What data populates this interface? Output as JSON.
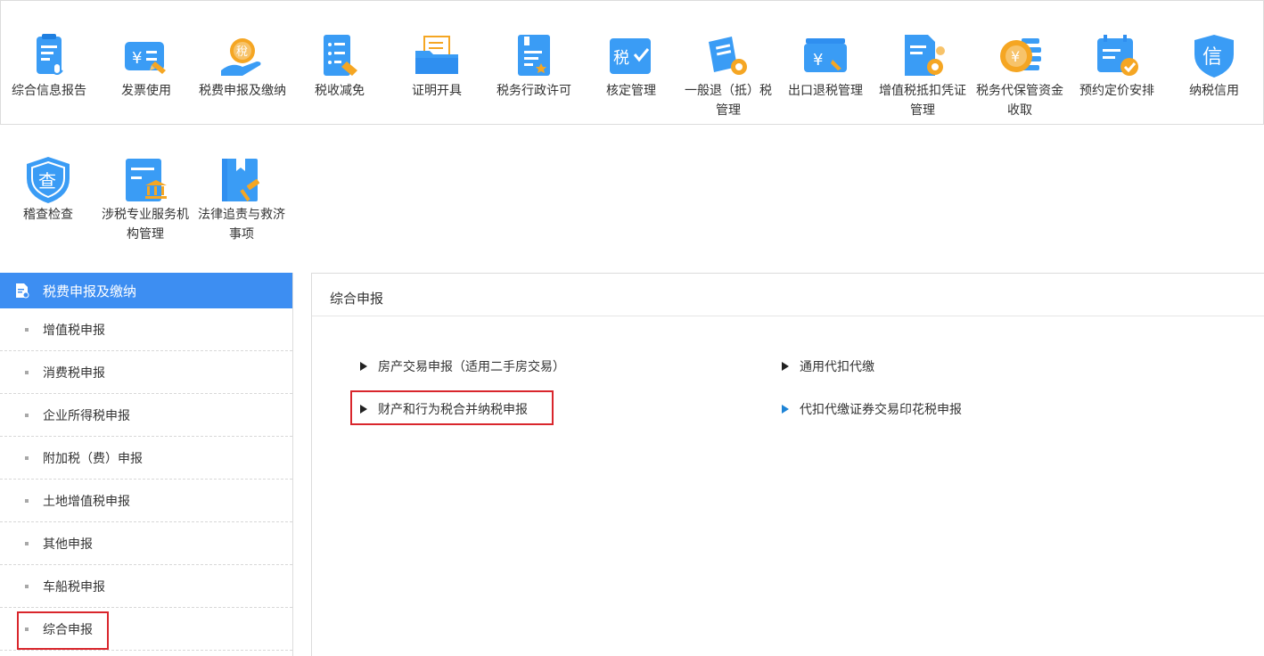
{
  "nav_row1": [
    {
      "label": "综合信息报告",
      "icon": "report-mic-icon"
    },
    {
      "label": "发票使用",
      "icon": "invoice-icon"
    },
    {
      "label": "税费申报及缴纳",
      "icon": "tax-payment-hand-icon"
    },
    {
      "label": "税收减免",
      "icon": "tax-reduction-icon"
    },
    {
      "label": "证明开具",
      "icon": "certificate-folder-icon"
    },
    {
      "label": "税务行政许可",
      "icon": "admin-license-icon"
    },
    {
      "label": "核定管理",
      "icon": "tax-verify-icon"
    },
    {
      "label": "一般退（抵）税管理",
      "icon": "refund-gear-icon"
    },
    {
      "label": "出口退税管理",
      "icon": "export-refund-icon"
    },
    {
      "label": "增值税抵扣凭证管理",
      "icon": "vat-voucher-gear-icon"
    },
    {
      "label": "税务代保管资金收取",
      "icon": "custody-coin-icon"
    },
    {
      "label": "预约定价安排",
      "icon": "calendar-check-icon"
    },
    {
      "label": "纳税信用",
      "icon": "credit-shield-icon"
    }
  ],
  "nav_row2": [
    {
      "label": "稽查检查",
      "icon": "inspect-shield-icon"
    },
    {
      "label": "涉税专业服务机构管理",
      "icon": "institution-icon"
    },
    {
      "label": "法律追责与救济事项",
      "icon": "law-book-gavel-icon"
    }
  ],
  "sidebar": {
    "title": "税费申报及缴纳",
    "items": [
      {
        "label": "增值税申报"
      },
      {
        "label": "消费税申报"
      },
      {
        "label": "企业所得税申报"
      },
      {
        "label": "附加税（费）申报"
      },
      {
        "label": "土地增值税申报"
      },
      {
        "label": "其他申报"
      },
      {
        "label": "车船税申报"
      },
      {
        "label": "综合申报"
      }
    ]
  },
  "panel": {
    "title": "综合申报",
    "links": [
      {
        "label": "房产交易申报（适用二手房交易）"
      },
      {
        "label": "通用代扣代缴"
      },
      {
        "label": "财产和行为税合并纳税申报"
      },
      {
        "label": "代扣代缴证券交易印花税申报"
      }
    ]
  },
  "colors": {
    "accent": "#3d8ef2",
    "highlight_border": "#d9262c",
    "icon_blue": "#2f8ff0",
    "icon_orange": "#f5a623"
  }
}
